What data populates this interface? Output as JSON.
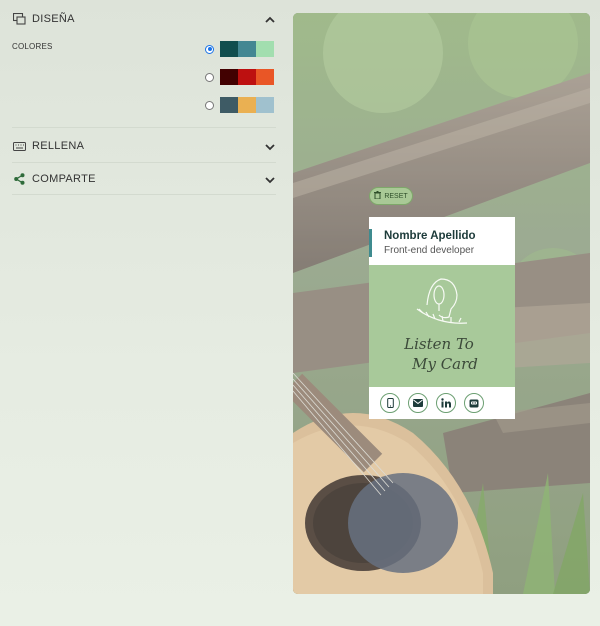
{
  "sections": {
    "disena": {
      "title": "DISEÑA",
      "icon": "design-icon",
      "expanded": true
    },
    "rellena": {
      "title": "RELLENA",
      "icon": "keyboard-icon",
      "expanded": false
    },
    "comparte": {
      "title": "COMPARTE",
      "icon": "share-icon",
      "expanded": false
    }
  },
  "colors": {
    "label": "COLORES",
    "palettes": [
      {
        "selected": true,
        "colors": [
          "#114e4e",
          "#438792",
          "#a2deaf"
        ]
      },
      {
        "selected": false,
        "colors": [
          "#420101",
          "#bd1010",
          "#e95626"
        ]
      },
      {
        "selected": false,
        "colors": [
          "#3e5b65",
          "#eab052",
          "#a0c1ce"
        ]
      }
    ]
  },
  "preview": {
    "reset_label": "RESET",
    "card": {
      "name": "Nombre Apellido",
      "job": "Front-end developer",
      "logo_text_line1": "Listen To",
      "logo_text_line2": "My Card",
      "social": [
        "mobile-icon",
        "email-icon",
        "linkedin-icon",
        "github-icon"
      ]
    }
  }
}
